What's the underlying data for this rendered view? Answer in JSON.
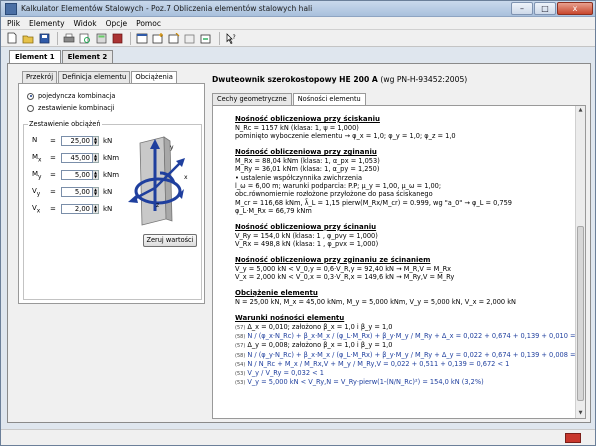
{
  "window": {
    "title": "Kalkulator Elementów Stalowych - Poz.7 Obliczenia elementów stalowych hali",
    "minimize": "–",
    "maximize": "□",
    "close": "x"
  },
  "menu": [
    "Plik",
    "Elementy",
    "Widok",
    "Opcje",
    "Pomoc"
  ],
  "toolbar": {
    "icons": [
      "new-icon",
      "open-icon",
      "save-icon",
      "print-icon",
      "preview-icon",
      "calc-icon",
      "export-icon",
      "window-icon",
      "add-element-icon",
      "copy-element-icon",
      "delete-element-icon",
      "element-settings-icon",
      "help-icon"
    ]
  },
  "doc_tabs": [
    "Element 1",
    "Element 2"
  ],
  "left_tabs": [
    "Przekrój",
    "Definicja elementu",
    "Obciążenia"
  ],
  "radio": {
    "opt1": "pojedyncza kombinacja",
    "opt2": "zestawienie kombinacji"
  },
  "group_label": "Zestawienie obciążeń",
  "fields": [
    {
      "label": "N",
      "sub": "",
      "value": "25,00",
      "unit": "kN"
    },
    {
      "label": "M",
      "sub": "x",
      "value": "45,00",
      "unit": "kNm"
    },
    {
      "label": "M",
      "sub": "y",
      "value": "5,00",
      "unit": "kNm"
    },
    {
      "label": "V",
      "sub": "y",
      "value": "5,00",
      "unit": "kN"
    },
    {
      "label": "V",
      "sub": "x",
      "value": "2,00",
      "unit": "kN"
    }
  ],
  "zero_button": "Zeruj wartości",
  "heading": {
    "main": "Dwuteownik szerokostopowy HE 200 A",
    "sub": "(wg PN-H-93452:2005)"
  },
  "right_tabs": [
    "Cechy geometryczne",
    "Nośności elementu"
  ],
  "sections": [
    {
      "title": "Nośność obliczeniowa przy ściskaniu",
      "lines": [
        {
          "t": "N_Rc = 1157 kN  (klasa: 1, ψ = 1,000)"
        },
        {
          "t": "pominięto wyboczenie elementu → φ_x = 1,0;  φ_y = 1,0;  φ_z = 1,0"
        }
      ]
    },
    {
      "title": "Nośność obliczeniowa przy zginaniu",
      "lines": [
        {
          "t": "M_Rx = 88,04 kNm  (klasa: 1, α_px = 1,053)"
        },
        {
          "t": "M_Ry = 36,01 kNm  (klasa: 1, α_py = 1,250)"
        },
        {
          "t": "• ustalenie współczynnika zwichrzenia"
        },
        {
          "t": "l_ω = 6,00 m;  warunki podparcia: P.P;  μ_y = 1,00,  μ_ω = 1,00;"
        },
        {
          "t": "obc.równomiernie rozłożone przyłożone do pasa ściskanego"
        },
        {
          "t": "M_cr = 116,68 kNm,  λ̄_L = 1,15 pierw(M_Rx/M_cr) = 0.999,  wg \"a_0\" → φ_L = 0,759"
        },
        {
          "t": "φ_L·M_Rx = 66,79 kNm"
        }
      ]
    },
    {
      "title": "Nośność obliczeniowa przy ścinaniu",
      "lines": [
        {
          "t": "V_Ry = 154,0 kN  (klasa: 1 , φ_pvy = 1,000)"
        },
        {
          "t": "V_Rx = 498,8 kN  (klasa: 1 , φ_pvx = 1,000)"
        }
      ]
    },
    {
      "title": "Nośność obliczeniowa przy zginaniu ze ścinaniem",
      "lines": [
        {
          "t": "V_y = 5,000 kN  <  V_0,y = 0,6·V_R,y = 92,40 kN  →  M_R,V = M_Rx"
        },
        {
          "t": "V_x = 2,000 kN  <  V_0,x = 0,3·V_R,x = 149,6 kN  →  M_Ry,V = M_Ry"
        }
      ]
    },
    {
      "title": "Obciążenie elementu",
      "lines": [
        {
          "t": "N = 25,00 kN,    M_x = 45,00 kNm,    M_y = 5,000 kNm,    V_y = 5,000 kN,    V_x = 2,000 kN"
        }
      ]
    },
    {
      "title": "Warunki nośności elementu",
      "lines": [
        {
          "n": "(57)",
          "t": "Δ_x = 0,010;    założono β_x = 1,0 i β_y = 1,0"
        },
        {
          "n": "(58)",
          "t": "N / (φ_x·N_Rc) + β_x·M_x / (φ_L·M_Rx) + β_y·M_y / M_Ry + Δ_x = 0,022 + 0,674 + 0,139 + 0,010 = 0,844  <  1",
          "blue": true
        },
        {
          "n": "(57)",
          "t": "Δ_y = 0,008;    założono β_x = 1,0 i β_y = 1,0"
        },
        {
          "n": "(58)",
          "t": "N / (φ_y·N_Rc) + β_x·M_x / (φ_L·M_Rx) + β_y·M_y / M_Ry + Δ_y = 0,022 + 0,674 + 0,139 + 0,008 = 0,842  <  1",
          "blue": true
        },
        {
          "n": "(54)",
          "t": "N / N_Rc + M_x / M_Rx,V + M_y / M_Ry,V = 0,022 + 0,511 + 0,139 = 0,672  <  1",
          "blue": true
        },
        {
          "n": "(53)",
          "t": "V_y / V_Ry = 0,032  <  1",
          "blue": true
        },
        {
          "n": "(53)",
          "t": "V_y = 5,000 kN  <  V_Ry,N = V_Ry·pierw(1-(N/N_Rc)²) = 154,0 kN       (3,2%)",
          "blue": true
        }
      ]
    }
  ]
}
